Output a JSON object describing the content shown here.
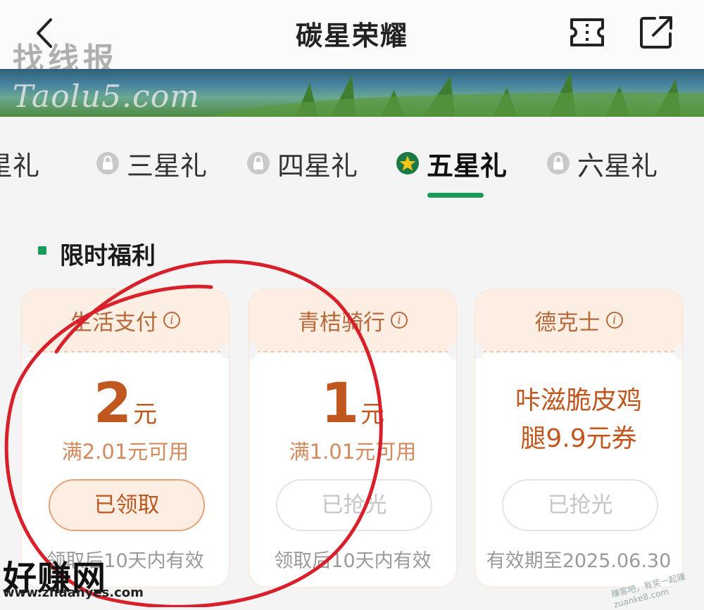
{
  "header": {
    "title": "碳星荣耀",
    "back_icon": "chevron-left-icon",
    "ticket_icon": "ticket-icon",
    "share_icon": "share-icon"
  },
  "watermarks": {
    "top_cn": "找线报",
    "top_en": "Taolu5.com",
    "bottom_cn": "好赚网",
    "bottom_url": "www.zhuanyes.com",
    "corner": "赚客吧，有奖一起赚 zuanke8.com"
  },
  "tabs": [
    {
      "label": "星礼",
      "locked": false,
      "active": false
    },
    {
      "label": "三星礼",
      "locked": true,
      "active": false
    },
    {
      "label": "四星礼",
      "locked": true,
      "active": false
    },
    {
      "label": "五星礼",
      "locked": false,
      "active": true,
      "icon": "star-badge-icon"
    },
    {
      "label": "六星礼",
      "locked": true,
      "active": false
    }
  ],
  "section": {
    "title": "限时福利"
  },
  "cards": [
    {
      "name": "生活支付",
      "amount": "2",
      "unit": "元",
      "condition": "满2.01元可用",
      "button": "已领取",
      "button_state": "claimed",
      "validity": "领取后10天内有效"
    },
    {
      "name": "青桔骑行",
      "amount": "1",
      "unit": "元",
      "condition": "满1.01元可用",
      "button": "已抢光",
      "button_state": "sold-out",
      "validity": "领取后10天内有效"
    },
    {
      "name": "德克士",
      "desc_line1": "咔滋脆皮鸡",
      "desc_line2": "腿9.9元券",
      "button": "已抢光",
      "button_state": "sold-out",
      "validity": "有效期至2025.06.30"
    }
  ],
  "colors": {
    "accent_green": "#1a9a58",
    "coupon_orange": "#c0571e",
    "coupon_head": "#fdeee3",
    "annotation_red": "#d8202a"
  }
}
